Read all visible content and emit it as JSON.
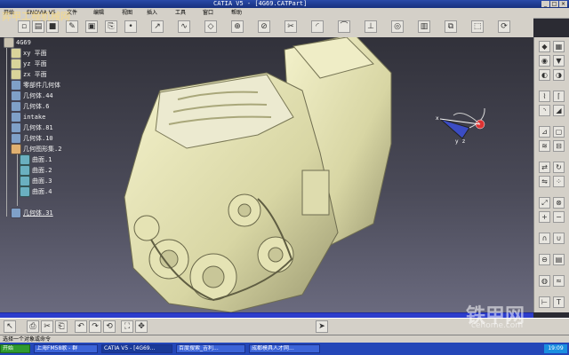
{
  "window": {
    "title": "CATIA V5 - [4G69.CATPart]",
    "controls": [
      "_",
      "□",
      "×"
    ]
  },
  "menubar": {
    "items": [
      "开始",
      "ENOVIA V5",
      "文件",
      "编辑",
      "视图",
      "插入",
      "工具",
      "窗口",
      "帮助"
    ]
  },
  "tree": {
    "root": "4G69",
    "items": [
      {
        "label": "xy 平面",
        "icon": "plane-icon",
        "indent": 1
      },
      {
        "label": "yz 平面",
        "icon": "plane-icon",
        "indent": 1
      },
      {
        "label": "zx 平面",
        "icon": "plane-icon",
        "indent": 1
      },
      {
        "label": "零部件几何体",
        "icon": "body-icon",
        "indent": 1
      },
      {
        "label": "几何体.44",
        "icon": "body-icon",
        "indent": 1
      },
      {
        "label": "几何体.6",
        "icon": "body-icon",
        "indent": 1
      },
      {
        "label": "intake",
        "icon": "body-icon",
        "indent": 1
      },
      {
        "label": "几何体.81",
        "icon": "body-icon",
        "indent": 1
      },
      {
        "label": "几何体.10",
        "icon": "body-icon",
        "indent": 1
      },
      {
        "label": "几何图形集.2",
        "icon": "geoset-icon",
        "indent": 1
      },
      {
        "label": "曲面.1",
        "icon": "surface-icon",
        "indent": 2
      },
      {
        "label": "曲面.2",
        "icon": "surface-icon",
        "indent": 2
      },
      {
        "label": "曲面.3",
        "icon": "surface-icon",
        "indent": 2
      },
      {
        "label": "曲面.4",
        "icon": "surface-icon",
        "indent": 2
      },
      {
        "label": "几何体.31",
        "icon": "body-icon",
        "indent": 1
      }
    ]
  },
  "compass": {
    "x_label": "x",
    "y_label": "y",
    "z_label": "z"
  },
  "status": {
    "text": "选择一个对象或命令"
  },
  "taskbar": {
    "start": "开始",
    "tasks": [
      "上海FM58歌 - 群",
      "CATIA V5 - [4G69...",
      "百度搜索_吉利...",
      "成都模具人才网..."
    ],
    "clock": "19:09"
  },
  "watermark": {
    "brand": "铁甲网",
    "url": "cehome.com",
    "top_left": "弈甲工程机械网"
  },
  "colors": {
    "model": "#e6e4b8",
    "viewport_top": "#31313a",
    "viewport_bottom": "#6a6a7e",
    "taskbar": "#2447b8",
    "scrollbar": "#2d3dcc"
  }
}
